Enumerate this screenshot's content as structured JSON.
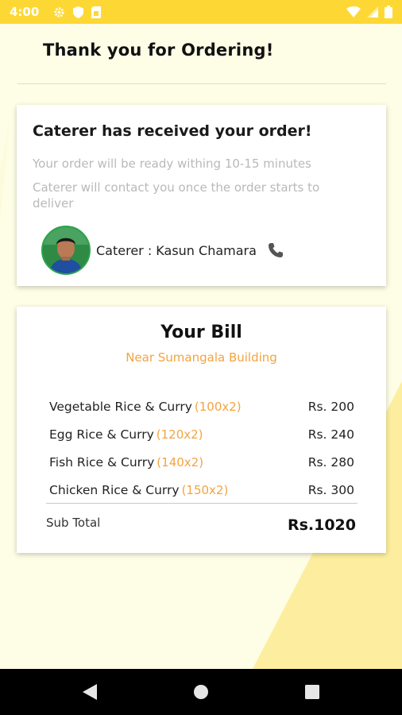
{
  "status_bar": {
    "time": "4:00",
    "icons": [
      "gear-icon",
      "shield-icon",
      "sim-card-icon",
      "wifi-icon",
      "signal-icon",
      "battery-icon"
    ]
  },
  "header": {
    "title": "Thank you for Ordering!"
  },
  "order_status": {
    "heading": "Caterer has received your order!",
    "ready_text": "Your order will be ready withing 10-15 minutes",
    "contact_text": "Caterer will contact you once the order starts to deliver",
    "caterer_label": "Caterer : Kasun Chamara",
    "phone_icon": "phone-icon"
  },
  "bill": {
    "title": "Your Bill",
    "location": "Near Sumangala Building",
    "items": [
      {
        "name": "Vegetable Rice & Curry",
        "qty": "(100x2)",
        "price": "Rs. 200"
      },
      {
        "name": "Egg Rice & Curry",
        "qty": "(120x2)",
        "price": "Rs. 240"
      },
      {
        "name": "Fish Rice & Curry",
        "qty": "(140x2)",
        "price": "Rs. 280"
      },
      {
        "name": "Chicken Rice & Curry",
        "qty": "(150x2)",
        "price": "Rs. 300"
      }
    ],
    "subtotal_label": "Sub Total",
    "subtotal_value": "Rs.1020"
  },
  "nav_bar": {
    "buttons": [
      "back-icon",
      "home-icon",
      "recents-icon"
    ]
  },
  "colors": {
    "accent_yellow": "#fdd835",
    "accent_orange": "#f4a340",
    "background": "#fefde6"
  }
}
